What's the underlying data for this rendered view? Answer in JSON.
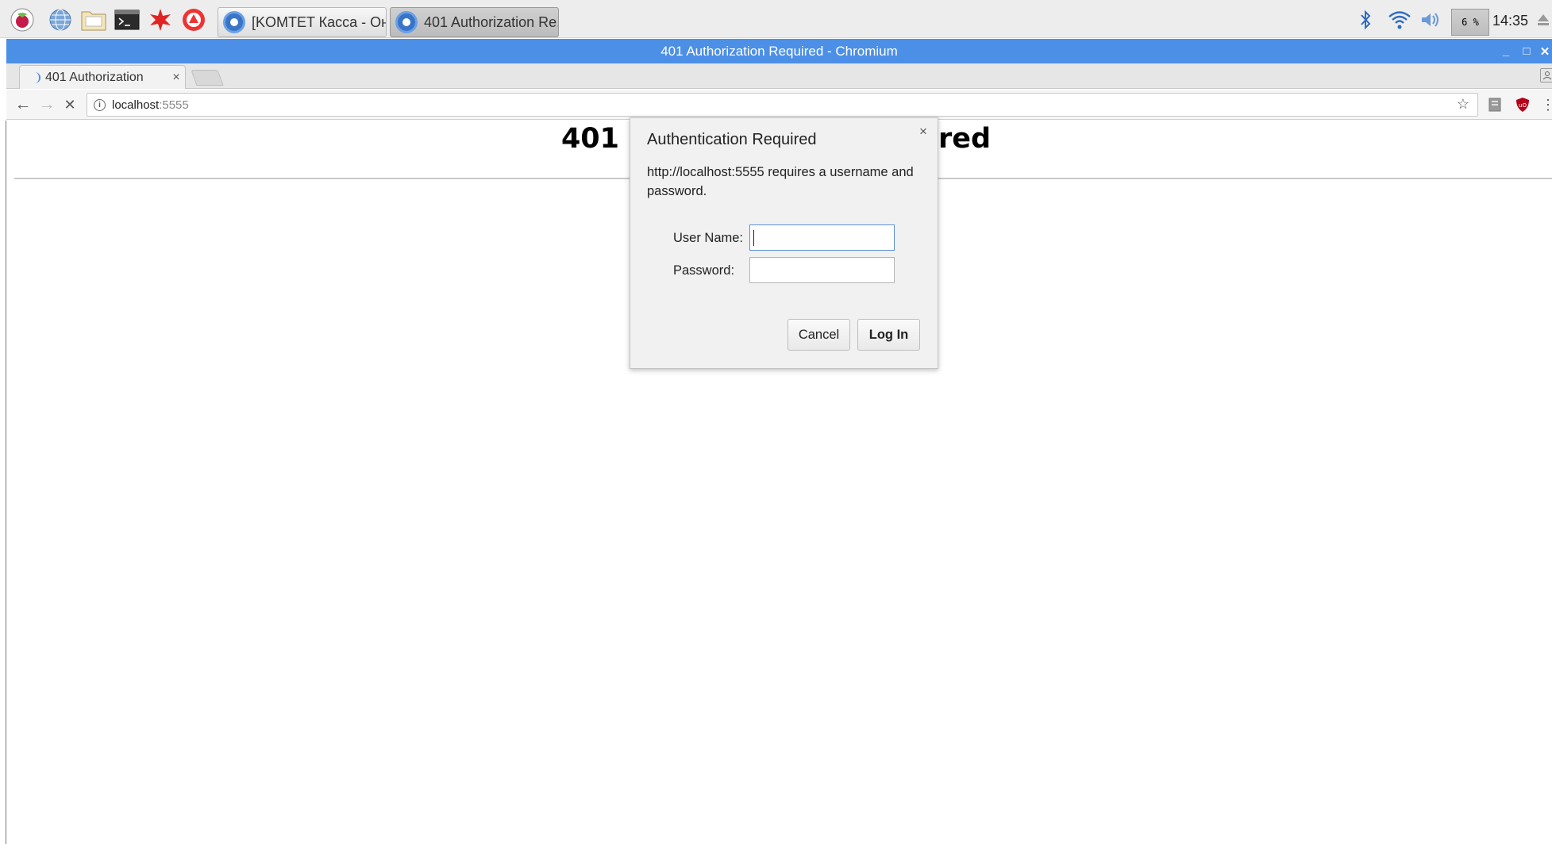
{
  "taskbar": {
    "launchers": [
      {
        "icon": "raspberry-menu-icon"
      },
      {
        "icon": "web-browser-icon"
      },
      {
        "icon": "file-manager-icon"
      },
      {
        "icon": "terminal-icon"
      },
      {
        "icon": "math-kernel-icon"
      },
      {
        "icon": "wolfram-icon"
      }
    ],
    "tasks": [
      {
        "label": "[KOMTET Касса - Он...",
        "active": false
      },
      {
        "label": "401 Authorization Re...",
        "active": true
      }
    ],
    "cpu_label": "6 %",
    "clock": "14:35"
  },
  "window": {
    "title": "401 Authorization Required - Chromium",
    "controls": {
      "minimize": "_",
      "maximize": "□",
      "close": "✕"
    }
  },
  "tabs": [
    {
      "title": "401 Authorization",
      "close": "×"
    }
  ],
  "toolbar": {
    "back": "←",
    "forward": "→",
    "stop": "✕",
    "info": "i",
    "url_host": "localhost",
    "url_port": ":5555",
    "star": "☆"
  },
  "page": {
    "heading_left": "401",
    "heading_right": "ired"
  },
  "dialog": {
    "title": "Authentication Required",
    "close": "×",
    "message": "http://localhost:5555 requires a username and password.",
    "username_label": "User Name:",
    "password_label": "Password:",
    "username_value": "",
    "password_value": "",
    "cancel_label": "Cancel",
    "login_label": "Log In"
  },
  "colors": {
    "titlebar": "#4c8fe6",
    "dialog_bg": "#f1f1f1",
    "focus_border": "#5b8ed8"
  }
}
